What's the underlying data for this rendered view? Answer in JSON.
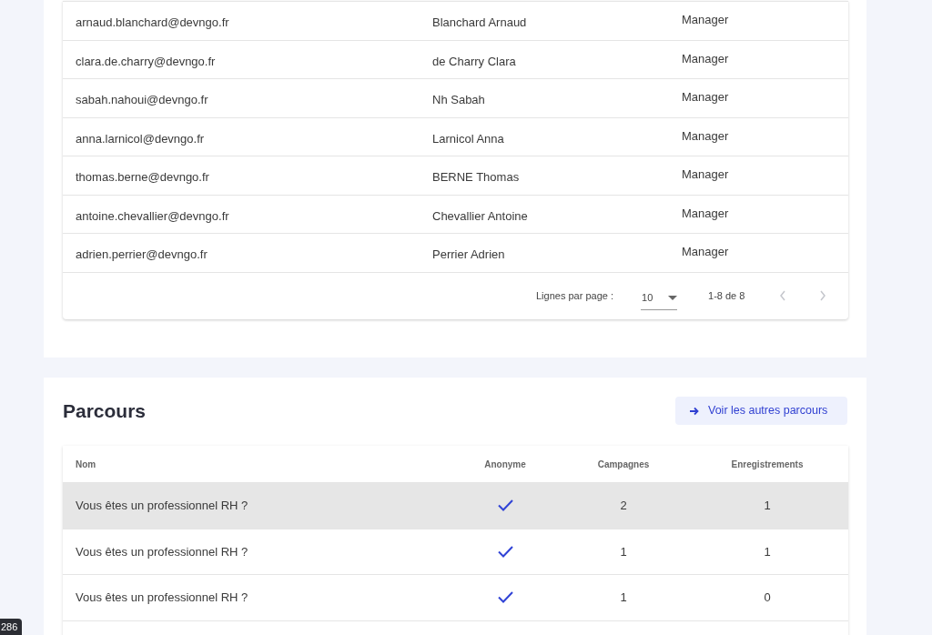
{
  "users_table": {
    "rows": [
      {
        "email": "arnaud.blanchard@devngo.fr",
        "name": "Blanchard Arnaud",
        "role": "Manager"
      },
      {
        "email": "clara.de.charry@devngo.fr",
        "name": "de Charry Clara",
        "role": "Manager"
      },
      {
        "email": "sabah.nahoui@devngo.fr",
        "name": "Nh Sabah",
        "role": "Manager"
      },
      {
        "email": "anna.larnicol@devngo.fr",
        "name": "Larnicol Anna",
        "role": "Manager"
      },
      {
        "email": "thomas.berne@devngo.fr",
        "name": "BERNE Thomas",
        "role": "Manager"
      },
      {
        "email": "antoine.chevallier@devngo.fr",
        "name": "Chevallier Antoine",
        "role": "Manager"
      },
      {
        "email": "adrien.perrier@devngo.fr",
        "name": "Perrier Adrien",
        "role": "Manager"
      }
    ],
    "pagination": {
      "rows_per_page_label": "Lignes par page :",
      "rows_per_page": "10",
      "range": "1-8 de 8",
      "prev_disabled": true,
      "next_disabled": true
    }
  },
  "parcours": {
    "title": "Parcours",
    "button": "Voir les autres parcours",
    "columns": [
      "Nom",
      "Anonyme",
      "Campagnes",
      "Enregistrements"
    ],
    "rows": [
      {
        "name": "Vous êtes un professionnel RH ?",
        "anonymous": true,
        "campaigns": "2",
        "recordings": "1",
        "selected": true
      },
      {
        "name": "Vous êtes un professionnel RH ?",
        "anonymous": true,
        "campaigns": "1",
        "recordings": "1",
        "selected": false
      },
      {
        "name": "Vous êtes un professionnel RH ?",
        "anonymous": true,
        "campaigns": "1",
        "recordings": "0",
        "selected": false
      }
    ]
  },
  "corner_badge": "286"
}
